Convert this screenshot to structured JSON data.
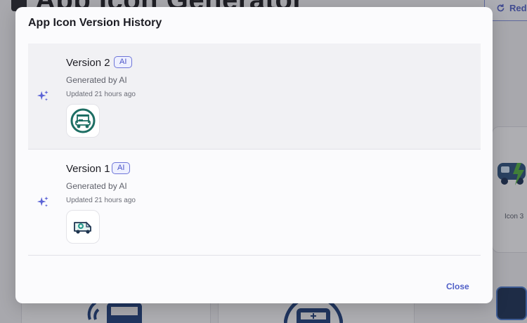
{
  "background": {
    "title": "App Icon Generator",
    "redo_label": "Redo",
    "icon3_label": "Icon 3"
  },
  "modal": {
    "title": "App Icon Version History",
    "close_label": "Close",
    "versions": [
      {
        "name": "Version 2",
        "badge": "AI",
        "description": "Generated by AI",
        "updated": "Updated 21 hours ago",
        "thumbnail_icon": "golf-cart-icon",
        "selected": true
      },
      {
        "name": "Version 1",
        "badge": "AI",
        "description": "Generated by AI",
        "updated": "Updated 21 hours ago",
        "thumbnail_icon": "van-icon",
        "selected": false
      }
    ]
  },
  "colors": {
    "accent": "#4a52c6",
    "sparkle": "#5b63d6",
    "selected_row": "#f1f1f4",
    "thumb_teal": "#1d6e63"
  }
}
